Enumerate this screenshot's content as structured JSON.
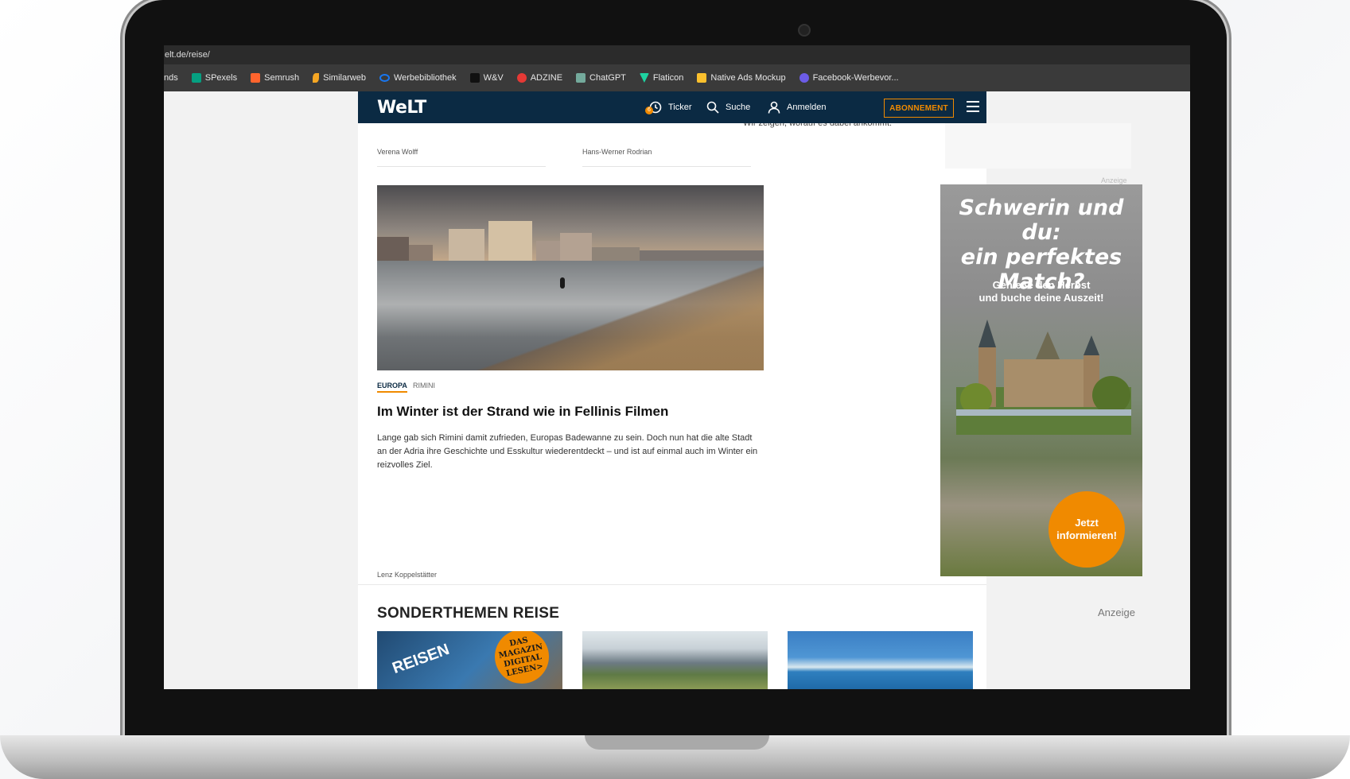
{
  "browser": {
    "url": "elt.de/reise/",
    "bookmarks": [
      {
        "label": "nds",
        "icon": "folder-icon",
        "color": "#3a3a3a"
      },
      {
        "label": "SPexels",
        "icon": "pexels-icon",
        "color": "#05a081"
      },
      {
        "label": "Semrush",
        "icon": "semrush-icon",
        "color": "#ff642d"
      },
      {
        "label": "Similarweb",
        "icon": "similarweb-icon",
        "color": "#f5a623"
      },
      {
        "label": "Werbebibliothek",
        "icon": "meta-icon",
        "color": "#1877f2"
      },
      {
        "label": "W&V",
        "icon": "wv-icon",
        "color": "#111111"
      },
      {
        "label": "ADZINE",
        "icon": "adzine-icon",
        "color": "#e53935"
      },
      {
        "label": "ChatGPT",
        "icon": "chatgpt-icon",
        "color": "#74aa9c"
      },
      {
        "label": "Flaticon",
        "icon": "flaticon-icon",
        "color": "#1ed3a1"
      },
      {
        "label": "Native Ads Mockup",
        "icon": "mockup-icon",
        "color": "#fbc02d"
      },
      {
        "label": "Facebook-Werbevor...",
        "icon": "facebook-icon",
        "color": "#6c5ce7"
      }
    ]
  },
  "header": {
    "logo": "WeLT",
    "ticker_label": "Ticker",
    "ticker_badge": "6",
    "search_label": "Suche",
    "login_label": "Anmelden",
    "subscribe_label": "ABONNEMENT",
    "brand_color": "#0b2a43",
    "accent_color": "#f08a00"
  },
  "previous_row": {
    "cut_text": "Wir zeigen, worauf es dabei ankommt.",
    "author_left": "Verena Wolff",
    "author_right": "Hans-Werner Rodrian",
    "ad_label": "Anzeige"
  },
  "article": {
    "category": "EUROPA",
    "location": "RIMINI",
    "headline": "Im Winter ist der Strand wie in Fellinis Filmen",
    "teaser": "Lange gab sich Rimini damit zufrieden, Europas Badewanne zu sein. Doch nun hat die alte Stadt an der Adria ihre Geschichte und Esskultur wiederentdeckt – und ist auf einmal auch im Winter ein reizvolles Ziel.",
    "author": "Lenz Koppelstätter"
  },
  "ad": {
    "title_line1": "Schwerin und du:",
    "title_line2": "ein perfektes",
    "title_line3": "Match?",
    "sub_line1": "Genieße den Herbst",
    "sub_line2": "und buche deine Auszeit!",
    "cta_line1": "Jetzt",
    "cta_line2": "informieren!"
  },
  "section": {
    "title": "SONDERTHEMEN REISE",
    "ad_label": "Anzeige",
    "thumb1_text": "REISEN",
    "thumb1_badge": "DAS MAGAZIN DIGITAL LESEN>"
  }
}
